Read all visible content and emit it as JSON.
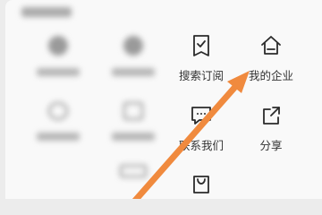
{
  "section": {
    "title": ""
  },
  "services": [
    {
      "label": "搜索订阅",
      "icon": "document-check-icon"
    },
    {
      "label": "我的企业",
      "icon": "home-enterprise-icon"
    },
    {
      "label": "联系我们",
      "icon": "chat-message-icon"
    },
    {
      "label": "分享",
      "icon": "share-icon"
    },
    {
      "label": "",
      "icon": "bag-icon"
    }
  ],
  "colors": {
    "arrow": "#f08a3e",
    "icon": "#2b2b2b",
    "background": "#f9f9f9"
  }
}
